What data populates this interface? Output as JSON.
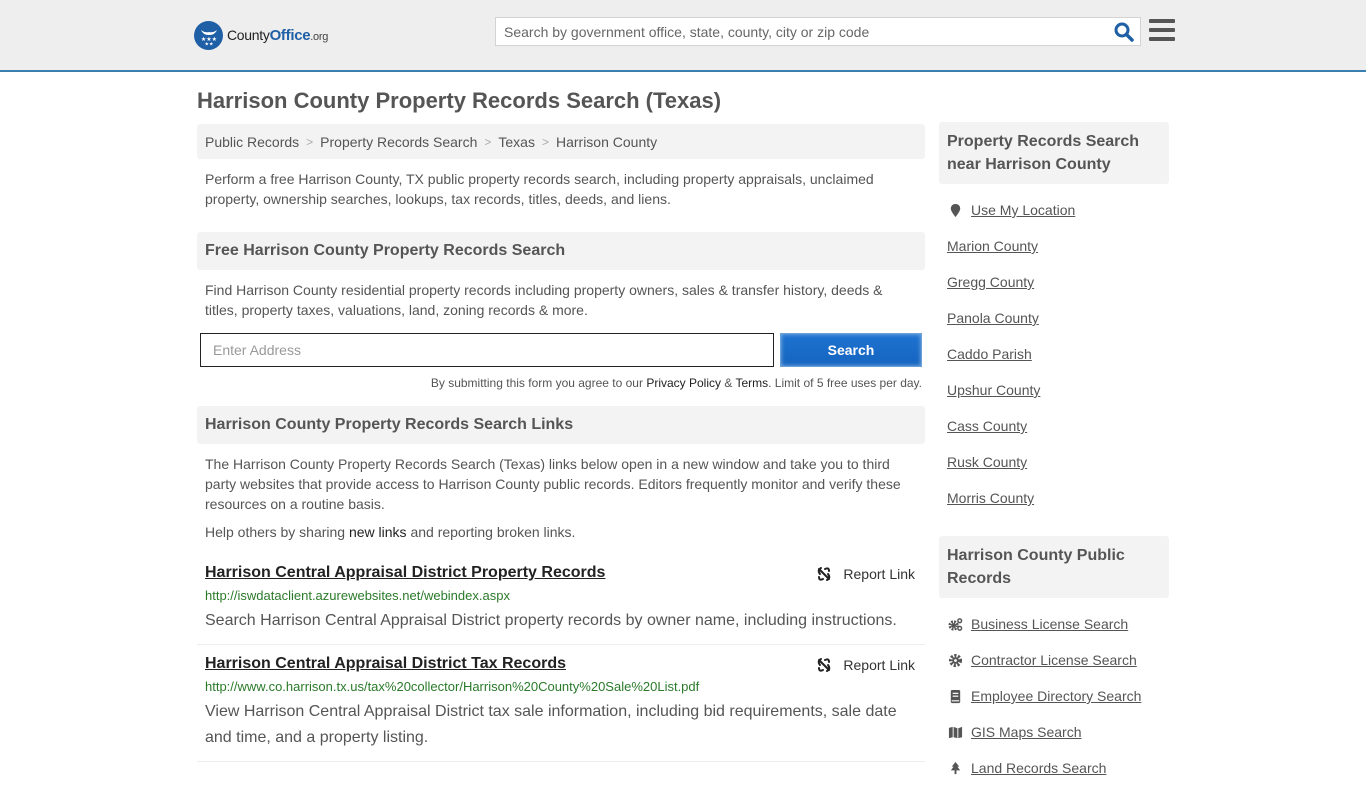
{
  "header": {
    "logo": {
      "brand_prefix": "County",
      "brand_mid": "Office",
      "brand_suffix": ".org"
    },
    "search": {
      "placeholder": "Search by government office, state, county, city or zip code",
      "value": ""
    },
    "search_icon": "search-icon",
    "menu_icon": "hamburger-menu-icon"
  },
  "page": {
    "title": "Harrison County Property Records Search (Texas)"
  },
  "breadcrumb": [
    {
      "label": "Public Records"
    },
    {
      "label": "Property Records Search"
    },
    {
      "label": "Texas"
    },
    {
      "label": "Harrison County"
    }
  ],
  "intro": "Perform a free Harrison County, TX public property records search, including property appraisals, unclaimed property, ownership searches, lookups, tax records, titles, deeds, and liens.",
  "free_search": {
    "heading": "Free Harrison County Property Records Search",
    "text": "Find Harrison County residential property records including property owners, sales & transfer history, deeds & titles, property taxes, valuations, land, zoning records & more.",
    "address_placeholder": "Enter Address",
    "address_value": "",
    "button_label": "Search",
    "disclaimer_prefix": "By submitting this form you agree to our ",
    "privacy_label": "Privacy Policy",
    "disclaimer_amp": " & ",
    "terms_label": "Terms",
    "disclaimer_suffix": ". Limit of 5 free uses per day."
  },
  "links_section": {
    "heading": "Harrison County Property Records Search Links",
    "text": "The Harrison County Property Records Search (Texas) links below open in a new window and take you to third party websites that provide access to Harrison County public records. Editors frequently monitor and verify these resources on a routine basis.",
    "help_prefix": "Help others by sharing ",
    "help_link": "new links",
    "help_suffix": " and reporting broken links.",
    "report_label": "Report Link",
    "items": [
      {
        "title": "Harrison Central Appraisal District Property Records",
        "url": "http://iswdataclient.azurewebsites.net/webindex.aspx",
        "description": "Search Harrison Central Appraisal District property records by owner name, including instructions."
      },
      {
        "title": "Harrison Central Appraisal District Tax Records",
        "url": "http://www.co.harrison.tx.us/tax%20collector/Harrison%20County%20Sale%20List.pdf",
        "description": "View Harrison Central Appraisal District tax sale information, including bid requirements, sale date and time, and a property listing."
      }
    ]
  },
  "sidebar": {
    "nearby": {
      "heading": "Property Records Search near Harrison County",
      "use_location": "Use My Location",
      "items": [
        "Marion County",
        "Gregg County",
        "Panola County",
        "Caddo Parish",
        "Upshur County",
        "Cass County",
        "Rusk County",
        "Morris County"
      ]
    },
    "public_records": {
      "heading": "Harrison County Public Records",
      "items": [
        {
          "label": "Business License Search",
          "icon": "cogs-icon"
        },
        {
          "label": "Contractor License Search",
          "icon": "gear-icon"
        },
        {
          "label": "Employee Directory Search",
          "icon": "book-icon"
        },
        {
          "label": "GIS Maps Search",
          "icon": "map-icon"
        },
        {
          "label": "Land Records Search",
          "icon": "tree-icon"
        }
      ]
    }
  },
  "colors": {
    "accent_blue": "#1f5fa6",
    "header_border": "#3a7fb0",
    "button_blue": "#1565c0",
    "url_green": "#2a7a2a"
  }
}
